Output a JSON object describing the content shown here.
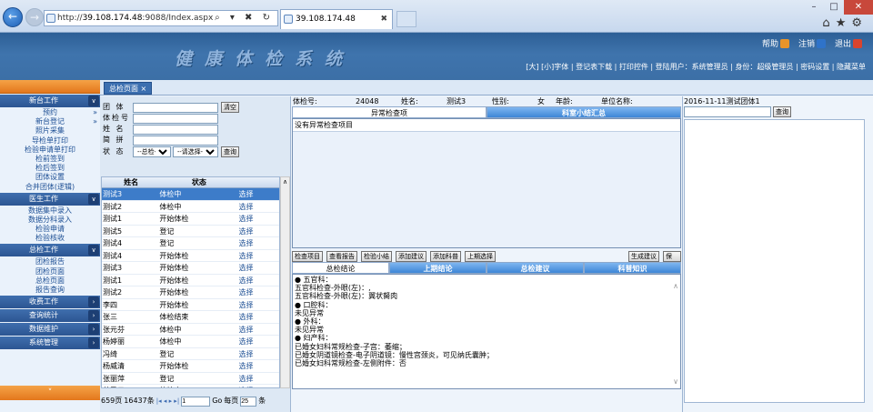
{
  "browser": {
    "url_prefix": "http://",
    "url_host": "39.108.174.48",
    "url_rest": ":9088/Index.aspx",
    "address_tools": "⌕ ▾ ✖ ↻",
    "tab_title": "39.108.174.48",
    "tab_close": "✖",
    "icons": [
      "home-icon",
      "star-icon",
      "gear-icon"
    ]
  },
  "app": {
    "title": "健康体检系统",
    "help": "帮助",
    "logout": "注销",
    "exit": "退出",
    "top_bar2": "[大] [小]字体 | 登记表下载 | 打印控件 | 登陆用户：系统管理员 | 身份：超级管理员 | 密码设置 | 隐藏菜单"
  },
  "sidebar": {
    "cats": [
      "新台工作",
      "医生工作",
      "总检工作",
      "收费工作",
      "查询统计",
      "数据维护",
      "系统管理"
    ],
    "group1": [
      "预约",
      "新台登记",
      "照片采集",
      "导检单打印",
      "检验申请单打印",
      "检前签到",
      "检后签到",
      "团体设置",
      "合并团体(逻辑)"
    ],
    "group2": [
      "数据集中录入",
      "数据分科录入",
      "检验申请",
      "检验核收"
    ],
    "group3": [
      "团检报告",
      "团检页面",
      "总检页面",
      "报告查询"
    ],
    "arrow": "»",
    "chev_down": "∨",
    "chev_right": "›",
    "footer_chev": "˅"
  },
  "tabs": {
    "home": "总检页面 ×"
  },
  "search": {
    "group_label": "团  体",
    "id_label": "体检号",
    "name_label": "姓  名",
    "simple_label": "简  拼",
    "status_label": "状  态",
    "clear_btn": "清空",
    "query_btn": "查询",
    "status_select": "--总检--",
    "select2": "--请选择--"
  },
  "grid": {
    "headers": [
      "姓名",
      "状态",
      ""
    ],
    "rows": [
      [
        "测试3",
        "体检中",
        "选择"
      ],
      [
        "测试2",
        "体检中",
        "选择"
      ],
      [
        "测试1",
        "开始体检",
        "选择"
      ],
      [
        "测试5",
        "登记",
        "选择"
      ],
      [
        "测试4",
        "登记",
        "选择"
      ],
      [
        "测试4",
        "开始体检",
        "选择"
      ],
      [
        "测试3",
        "开始体检",
        "选择"
      ],
      [
        "测试1",
        "开始体检",
        "选择"
      ],
      [
        "测试2",
        "开始体检",
        "选择"
      ],
      [
        "李四",
        "开始体检",
        "选择"
      ],
      [
        "张三",
        "体检结束",
        "选择"
      ],
      [
        "张元芬",
        "体检中",
        "选择"
      ],
      [
        "杨婷丽",
        "体检中",
        "选择"
      ],
      [
        "冯绮",
        "登记",
        "选择"
      ],
      [
        "杨威清",
        "开始体检",
        "选择"
      ],
      [
        "张丽萍",
        "登记",
        "选择"
      ],
      [
        "范民云",
        "体检中",
        "选择"
      ]
    ],
    "scroll_up": "∧"
  },
  "pager": {
    "pages": "659页",
    "records": "16437条",
    "nav_icons": "|◂ ◂ ▸ ▸|",
    "page_value": "1",
    "go": "Go",
    "per_page_label": "每页",
    "per_page_value": "25",
    "unit": "条"
  },
  "exam": {
    "id_label": "体检号:",
    "id": "24048",
    "name_label": "姓名:",
    "name": "测试3",
    "sex_label": "性别:",
    "sex": "女",
    "age_label": "年龄:",
    "unit_label": "单位名称:",
    "unit_value": "2016-11-11测试团体1"
  },
  "mid_tabs1": [
    "异常检查项",
    "科室小结汇总"
  ],
  "abnormal_text": "没有异常检查项目",
  "buttons": [
    "检查项目",
    "查看报告",
    "检验小结",
    "添加建议",
    "添加科普",
    "上期选择",
    "生成建议",
    "保 存"
  ],
  "mid_tabs2": [
    "总检结论",
    "上期结论",
    "总检建议",
    "科普知识"
  ],
  "conclusion_lines": [
    "● 五官科：",
    "五官科检查-外眼(左)：,",
    "五官科检查-外眼(左)：翼状胬肉",
    "● 口腔科：",
    "未见异常",
    "● 外科：",
    "未见异常",
    "● 妇产科：",
    "已婚女妇科常规检查-子宫：萎缩；",
    "已婚女阴道镜检查-电子阴道镜：慢性宫颈炎，可见纳氏囊肿；",
    "已婚女妇科常规检查-左侧附件：否"
  ],
  "right": {
    "query_btn": "查询"
  },
  "colors": {
    "accent_orange": "#e3771c",
    "nav_blue": "#2c5592",
    "selected_row": "#3d7cc9"
  }
}
